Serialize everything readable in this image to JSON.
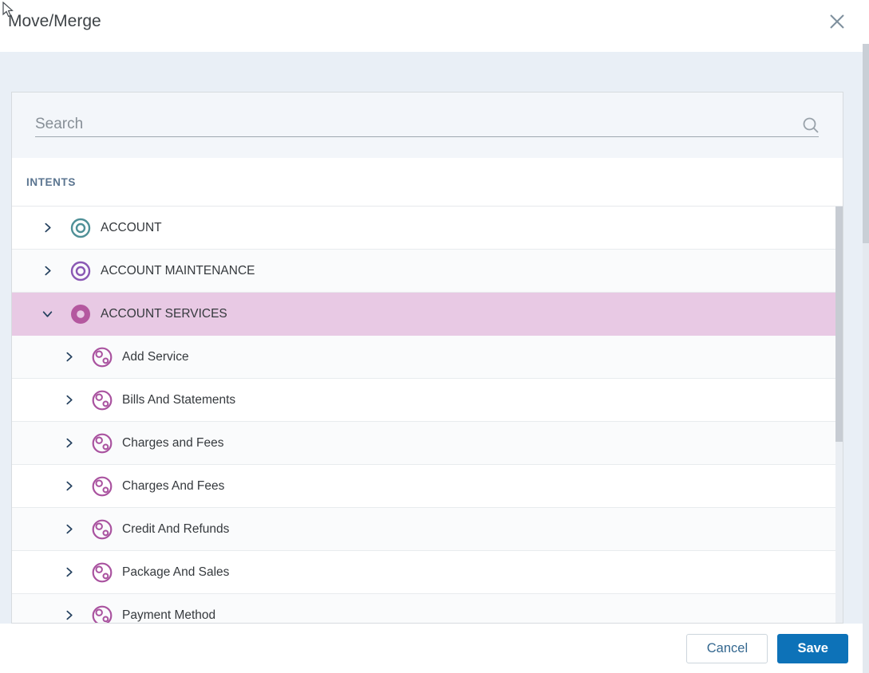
{
  "dialog": {
    "title": "Move/Merge"
  },
  "search": {
    "placeholder": "Search",
    "value": "",
    "icon": "magnifier-icon"
  },
  "tree": {
    "header": "INTENTS",
    "items": [
      {
        "label": "ACCOUNT",
        "level": 0,
        "icon": "double-ring",
        "icon_color": "#4f9097",
        "expanded": false,
        "selected": false
      },
      {
        "label": "ACCOUNT MAINTENANCE",
        "level": 0,
        "icon": "double-ring",
        "icon_color": "#8a58b4",
        "expanded": false,
        "selected": false
      },
      {
        "label": "ACCOUNT SERVICES",
        "level": 0,
        "icon": "donut",
        "icon_color": "#b4589f",
        "expanded": true,
        "selected": true
      },
      {
        "label": "Add Service",
        "level": 1,
        "icon": "intent",
        "icon_color": "#a9529f",
        "expanded": false,
        "selected": false
      },
      {
        "label": "Bills And Statements",
        "level": 1,
        "icon": "intent",
        "icon_color": "#a9529f",
        "expanded": false,
        "selected": false
      },
      {
        "label": "Charges and Fees",
        "level": 1,
        "icon": "intent",
        "icon_color": "#a9529f",
        "expanded": false,
        "selected": false
      },
      {
        "label": "Charges And Fees",
        "level": 1,
        "icon": "intent",
        "icon_color": "#a9529f",
        "expanded": false,
        "selected": false
      },
      {
        "label": "Credit And Refunds",
        "level": 1,
        "icon": "intent",
        "icon_color": "#a9529f",
        "expanded": false,
        "selected": false
      },
      {
        "label": "Package And Sales",
        "level": 1,
        "icon": "intent",
        "icon_color": "#a9529f",
        "expanded": false,
        "selected": false
      },
      {
        "label": "Payment Method",
        "level": 1,
        "icon": "intent",
        "icon_color": "#a9529f",
        "expanded": false,
        "selected": false
      }
    ]
  },
  "footer": {
    "cancel_label": "Cancel",
    "save_label": "Save"
  },
  "colors": {
    "accent_blue": "#0d72b8",
    "selected_row_bg": "#e8c9e4",
    "backdrop": "#e9eff6",
    "chevron": "#24405e",
    "teal_icon": "#4f9097",
    "purple_icon": "#8a58b4",
    "magenta_icon": "#b4589f",
    "sub_intent_icon": "#a9529f"
  }
}
